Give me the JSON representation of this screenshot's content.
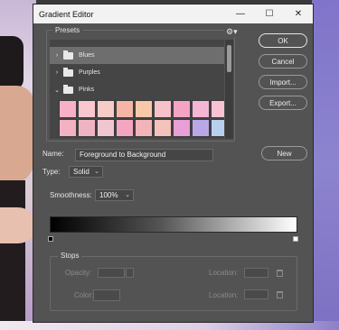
{
  "window": {
    "title": "Gradient Editor",
    "minimize": "—",
    "maximize": "☐",
    "close": "✕"
  },
  "presets": {
    "label": "Presets",
    "gear_icon": "⚙",
    "rows": [
      {
        "name": "Blues",
        "selected": true
      },
      {
        "name": "Purples",
        "selected": false
      },
      {
        "name": "Pinks",
        "selected": false
      }
    ],
    "swatch_colors": [
      [
        "#f7b0c6",
        "#f8c7cf",
        "#f7cbc6",
        "#f6b5a6",
        "#f7c9a9",
        "#f6c1c9",
        "#f4a3c5",
        "#f5b6d6",
        "#f9c2d3"
      ],
      [
        "#f3b1c1",
        "#efb4c4",
        "#f2c6d0",
        "#f4a6c1",
        "#f2b4b8",
        "#f4c1bb",
        "#e79fd6",
        "#b9a7e8",
        "#b8d0ee"
      ]
    ]
  },
  "buttons": {
    "ok": "OK",
    "cancel": "Cancel",
    "import": "Import...",
    "export": "Export...",
    "new": "New"
  },
  "fields": {
    "name_label": "Name:",
    "name_value": "Foreground to Background",
    "type_label": "Type:",
    "type_value": "Solid",
    "smoothness_label": "Smoothness:",
    "smoothness_value": "100%"
  },
  "stops": {
    "label": "Stops",
    "opacity_label": "Opacity:",
    "color_label": "Color:",
    "location_label": "Location:",
    "location_label_2": "Location:"
  }
}
